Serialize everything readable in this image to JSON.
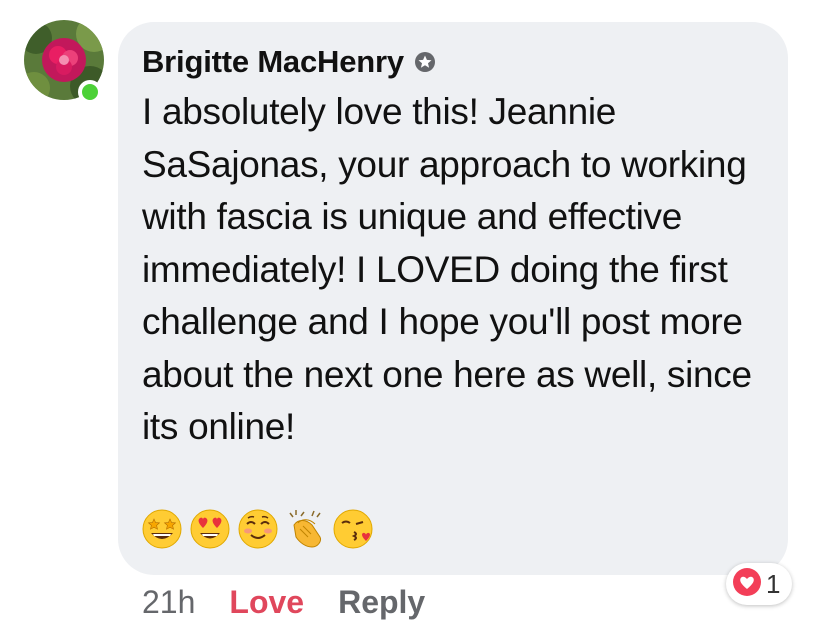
{
  "comment": {
    "author": "Brigitte MacHenry",
    "badge_icon": "top-fan-badge-icon",
    "text": "I absolutely love this! Jeannie SaSajonas, your approach to working with fascia is unique and effective immediately! I LOVED doing the first challenge and I hope you'll post more about the next one here as well, since its online!",
    "emojis": [
      "star-struck-emoji",
      "heart-eyes-emoji",
      "smiling-blush-emoji",
      "clapping-hands-emoji",
      "kissing-heart-emoji"
    ]
  },
  "meta": {
    "time": "21h",
    "love_label": "Love",
    "reply_label": "Reply"
  },
  "reactions": {
    "icon": "love-reaction-icon",
    "count": "1"
  },
  "colors": {
    "bubble_bg": "#eef0f3",
    "love": "#e0475c",
    "online": "#4cd137",
    "muted": "#65676b"
  }
}
